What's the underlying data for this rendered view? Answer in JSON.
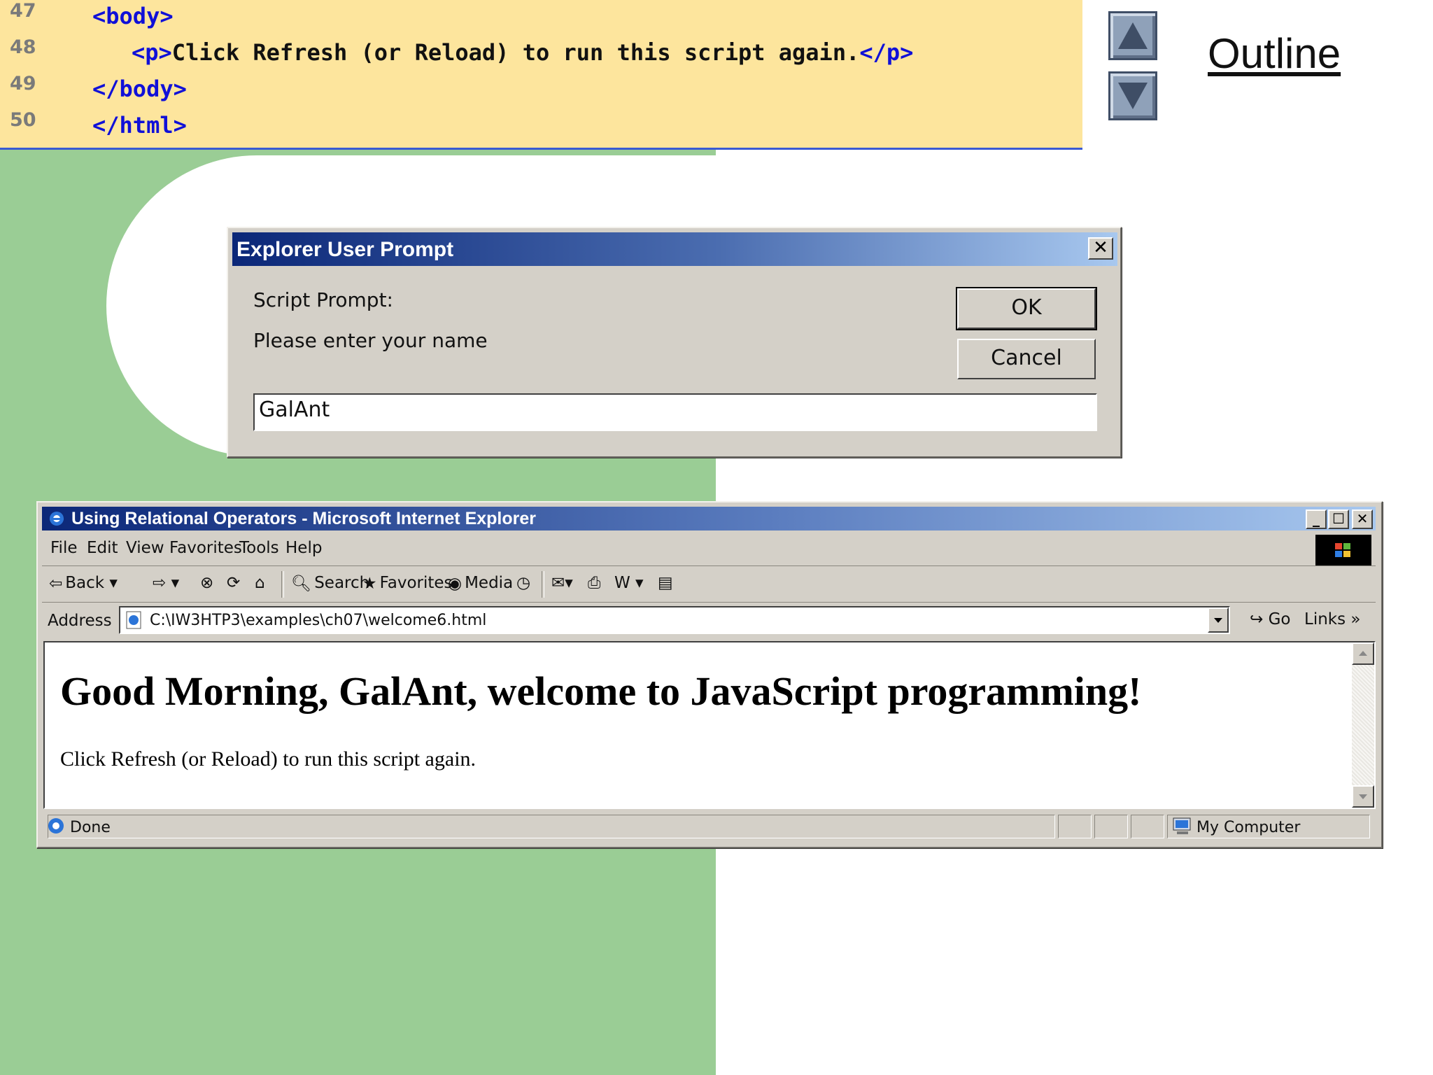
{
  "code": {
    "lines": [
      {
        "no": "47",
        "text": "<body>"
      },
      {
        "no": "48",
        "text": "<p>Click Refresh (or Reload) to run this script again.</p>"
      },
      {
        "no": "49",
        "text": "</body>"
      },
      {
        "no": "50",
        "text": "</html>"
      }
    ],
    "line48_open": "<p>",
    "line48_body": "Click Refresh (or Reload) to run this script again.",
    "line48_close": "</p>"
  },
  "nav": {
    "outline_label": "Outline",
    "up_icon": "up-arrow-icon",
    "down_icon": "down-arrow-icon"
  },
  "dialog": {
    "title": "Explorer User Prompt",
    "script_prompt": "Script Prompt:",
    "message": "Please enter your name",
    "ok_label": "OK",
    "cancel_label": "Cancel",
    "input_value": "GalAnt"
  },
  "ie": {
    "title": "Using Relational Operators - Microsoft Internet Explorer",
    "menu": [
      "File",
      "Edit",
      "View",
      "Favorites",
      "Tools",
      "Help"
    ],
    "toolbar": {
      "back": "Back",
      "search": "Search",
      "favorites": "Favorites",
      "media": "Media"
    },
    "address_label": "Address",
    "address_value": "C:\\IW3HTP3\\examples\\ch07\\welcome6.html",
    "go_label": "Go",
    "links_label": "Links",
    "heading": "Good Morning, GalAnt, welcome to JavaScript programming!",
    "paragraph": "Click Refresh (or Reload) to run this script again.",
    "status": "Done",
    "zone": "My Computer"
  },
  "colors": {
    "code_bg": "#fde59d",
    "tag": "#1010d8",
    "green": "#9acd95",
    "title_dark": "#0b2778",
    "title_light": "#a8c8ef"
  }
}
